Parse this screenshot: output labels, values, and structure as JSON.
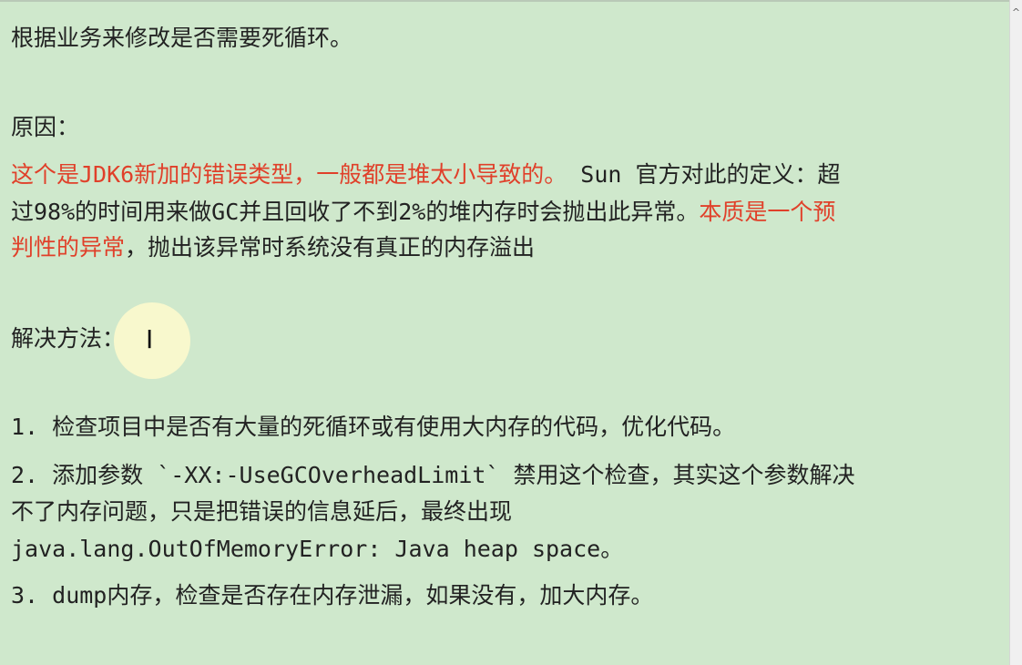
{
  "content": {
    "line1": "根据业务来修改是否需要死循环。",
    "reason_heading": "原因：",
    "reason": {
      "red_1": "这个是JDK6新加的错误类型，一般都是堆太小导致的。",
      "normal_1": "Sun 官方对此的定义：超",
      "normal_2": "过98%的时间用来做GC并且回收了不到2%的堆内存时会抛出此异常。",
      "red_2": "本质是一个预",
      "red_3": "判性的异常",
      "normal_3": "，抛出该异常时系统没有真正的内存溢出"
    },
    "solution_heading": "解决方法：",
    "items": [
      "1. 检查项目中是否有大量的死循环或有使用大内存的代码，优化代码。",
      "2. 添加参数 `-XX:-UseGCOverheadLimit` 禁用这个检查，其实这个参数解决",
      "不了内存问题，只是把错误的信息延后，最终出现",
      "java.lang.OutOfMemoryError: Java heap space。",
      "3. dump内存，检查是否存在内存泄漏，如果没有，加大内存。"
    ]
  },
  "icons": {
    "cursor": "text-cursor-icon",
    "scroll_up": "scroll-up-arrow-icon"
  },
  "colors": {
    "background": "#cfe8cc",
    "highlight_text": "#e0402a",
    "text": "#222222"
  }
}
